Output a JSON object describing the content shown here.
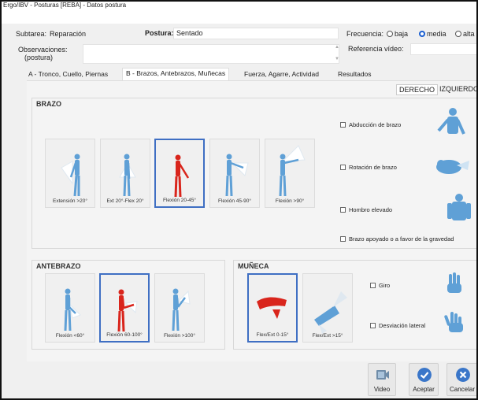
{
  "window": {
    "title": "Ergo/IBV - Posturas [REBA] - Datos postura"
  },
  "header": {
    "subtask_label": "Subtarea:",
    "subtask_value": "Reparación",
    "posture_label": "Postura:",
    "posture_value": "Sentado",
    "frequency_label": "Frecuencia:",
    "frequency_options": [
      "baja",
      "media",
      "alta"
    ],
    "frequency_selected": "media",
    "observations_label": "Observaciones:",
    "observations_sublabel": "(postura)",
    "observations_value": "",
    "video_ref_label": "Referencia vídeo:",
    "video_ref_value": ""
  },
  "tabs": [
    {
      "label": "A - Tronco, Cuello, Piernas",
      "active": false
    },
    {
      "label": "B - Brazos, Antebrazos, Muñecas",
      "active": true
    },
    {
      "label": "Fuerza, Agarre, Actividad",
      "active": false
    },
    {
      "label": "Resultados",
      "active": false
    }
  ],
  "side_tabs": {
    "right": "DERECHO",
    "left": "IZQUIERDO",
    "selected": "DERECHO"
  },
  "arm": {
    "title": "BRAZO",
    "options": [
      {
        "label": "Extensión >20°",
        "selected": false
      },
      {
        "label": "Ext 20°-Flex 20°",
        "selected": false
      },
      {
        "label": "Flexión 20-45°",
        "selected": true
      },
      {
        "label": "Flexión 45-90°",
        "selected": false
      },
      {
        "label": "Flexión >90°",
        "selected": false
      }
    ],
    "checks": [
      {
        "label": "Abducción de brazo",
        "checked": false,
        "icon": "arm-abduction-icon"
      },
      {
        "label": "Rotación de brazo",
        "checked": false,
        "icon": "arm-rotation-icon"
      },
      {
        "label": "Hombro elevado",
        "checked": false,
        "icon": "raised-shoulder-icon"
      },
      {
        "label": "Brazo apoyado o a favor de la gravedad",
        "checked": false
      }
    ]
  },
  "forearm": {
    "title": "ANTEBRAZO",
    "options": [
      {
        "label": "Flexión <60°",
        "selected": false
      },
      {
        "label": "Flexión 60-100°",
        "selected": true
      },
      {
        "label": "Flexión >100°",
        "selected": false
      }
    ]
  },
  "wrist": {
    "title": "MUÑECA",
    "options": [
      {
        "label": "Flex/Ext 0-15°",
        "selected": true
      },
      {
        "label": "Flex/Ext >15°",
        "selected": false
      }
    ],
    "checks": [
      {
        "label": "Giro",
        "checked": false,
        "icon": "wrist-twist-icon"
      },
      {
        "label": "Desviación lateral",
        "checked": false,
        "icon": "wrist-deviation-icon"
      }
    ]
  },
  "buttons": [
    {
      "label": "Video",
      "icon": "video-icon"
    },
    {
      "label": "Aceptar",
      "icon": "check-icon"
    },
    {
      "label": "Cancelar",
      "icon": "cancel-icon"
    }
  ],
  "colors": {
    "selected_figure": "#d9251c",
    "figure": "#5fa0d6",
    "accent": "#1a5fd1",
    "selected_border": "#3f6fc3"
  }
}
